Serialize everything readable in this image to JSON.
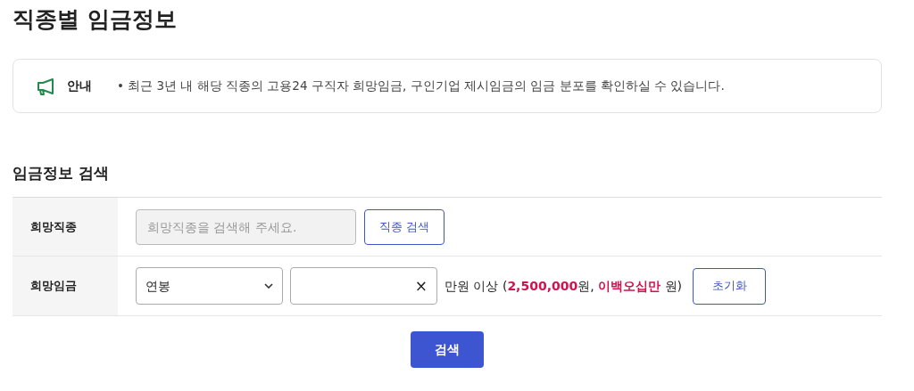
{
  "page_title": "직종별 임금정보",
  "notice": {
    "label": "안내",
    "text": "• 최근 3년 내 해당 직종의 고용24 구직자 희망임금, 구인기업 제시임금의 임금 분포를 확인하실 수 있습니다."
  },
  "section_title": "임금정보 검색",
  "job_row": {
    "label": "희망직종",
    "placeholder": "희망직종을 검색해 주세요.",
    "disabled": true,
    "button": "직종 검색"
  },
  "wage_row": {
    "label": "희망임금",
    "select_value": "연봉",
    "clear": "×",
    "hint": [
      {
        "text": "만원 이상 (",
        "highlight": false
      },
      {
        "text": "2,500,000",
        "highlight": true
      },
      {
        "text": "원, ",
        "highlight": false
      },
      {
        "text": "이백오십만",
        "highlight": true
      },
      {
        "text": " 원)",
        "highlight": false
      }
    ],
    "button": "초기화"
  },
  "search_button": "검색"
}
